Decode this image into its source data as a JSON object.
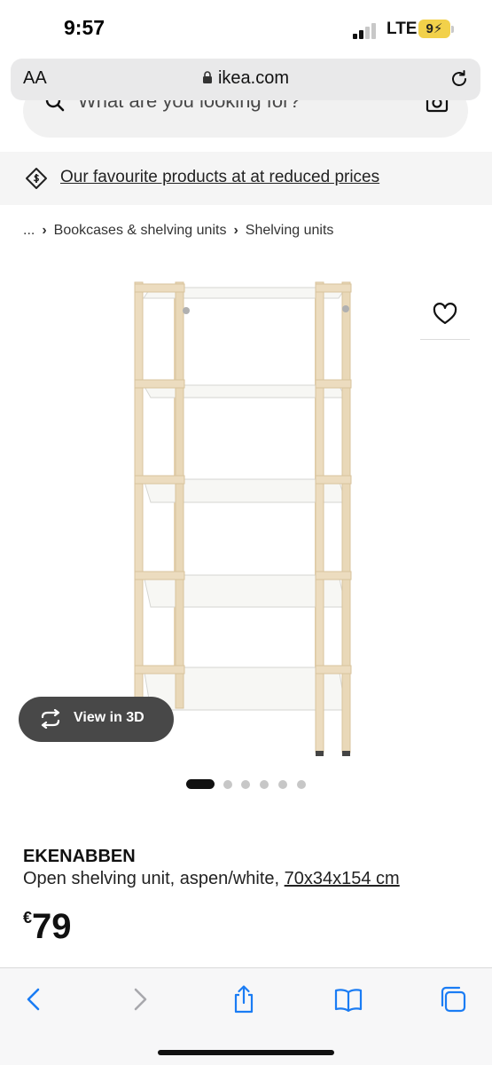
{
  "status_bar": {
    "time": "9:57",
    "network": "LTE",
    "battery": "9"
  },
  "browser": {
    "aa_label": "AA",
    "url": "ikea.com"
  },
  "search": {
    "placeholder": "What are you looking for?"
  },
  "promo": {
    "link_text": "Our favourite products at at reduced prices"
  },
  "breadcrumb": {
    "ellipsis": "...",
    "items": [
      "Bookcases & shelving units",
      "Shelving units"
    ]
  },
  "gallery": {
    "view3d_label": "View in 3D",
    "dot_count": 6,
    "active_dot": 0
  },
  "product": {
    "name": "EKENABBEN",
    "description": "Open shelving unit, aspen/white,",
    "size": "70x34x154 cm",
    "currency": "€",
    "price": "79"
  },
  "icons": {
    "lock": "lock-icon",
    "reload": "reload-icon",
    "search": "search-icon",
    "camera": "camera-icon",
    "promo": "price-tag-icon",
    "wishlist": "heart-icon",
    "view3d": "rotate-3d-icon",
    "back": "chevron-left-icon",
    "forward": "chevron-right-icon",
    "share": "share-icon",
    "bookmarks": "book-icon",
    "tabs": "tabs-icon"
  },
  "colors": {
    "battery": "#f2d14a",
    "view3d_bg": "#484848",
    "ios_blue": "#1a7cf4"
  }
}
